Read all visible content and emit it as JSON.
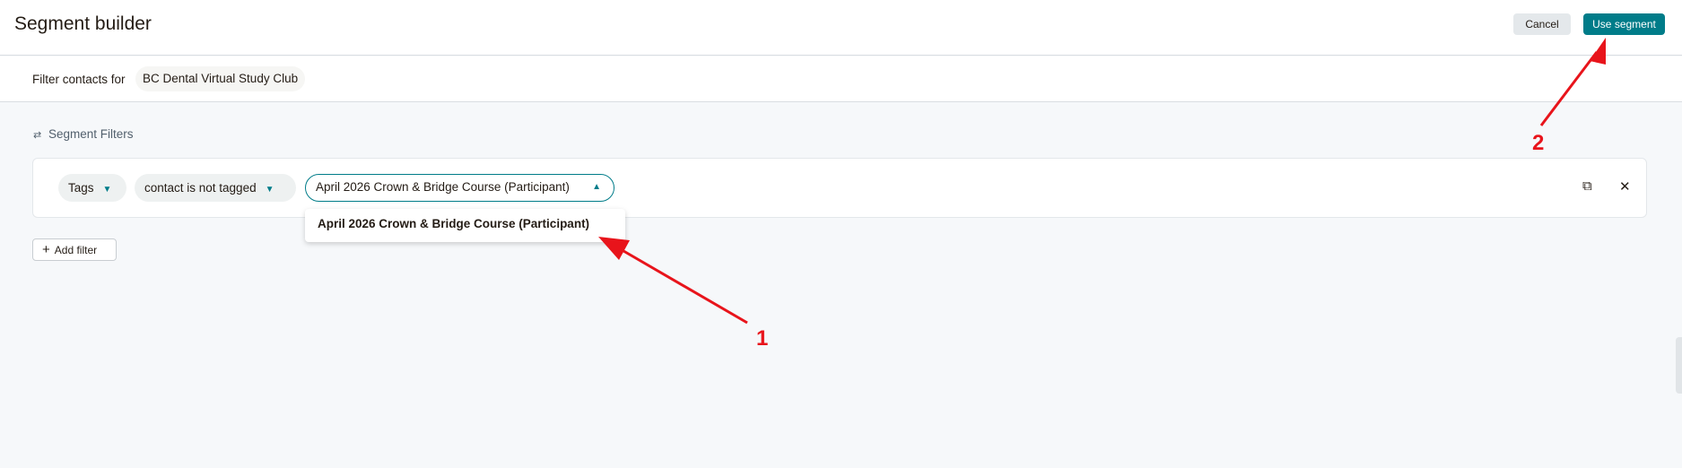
{
  "header": {
    "title": "Segment builder",
    "cancel_label": "Cancel",
    "use_segment_label": "Use segment"
  },
  "subbar": {
    "label": "Filter contacts for",
    "audience": "BC Dental Virtual Study Club"
  },
  "segment": {
    "heading": "Segment Filters",
    "filter": {
      "field": "Tags",
      "condition": "contact is not tagged",
      "value": "April 2026 Crown & Bridge Course (Participant)"
    },
    "dropdown_option": "April 2026 Crown & Bridge Course (Participant)",
    "add_filter_label": "Add filter"
  },
  "annotations": {
    "arrow1_number": "1",
    "arrow2_number": "2",
    "color": "#e8141b"
  },
  "icons": {
    "chevron": "chevron-down-icon",
    "duplicate": "duplicate-icon",
    "close": "close-icon",
    "sliders": "sliders-icon",
    "plus": "plus-icon"
  },
  "colors": {
    "accent": "#007c89",
    "page_bg": "#f6f8fa"
  }
}
